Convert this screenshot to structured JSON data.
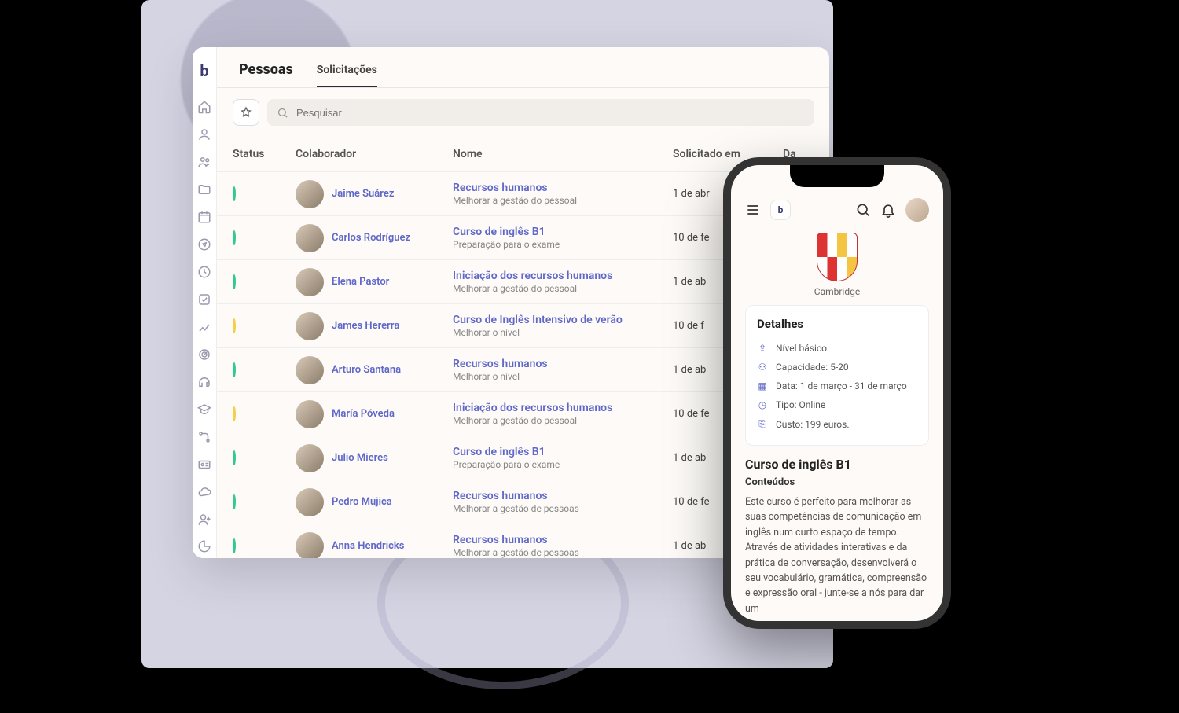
{
  "tabs": {
    "title": "Pessoas",
    "active": "Solicitações"
  },
  "search": {
    "placeholder": "Pesquisar"
  },
  "table": {
    "headers": {
      "status": "Status",
      "colaborador": "Colaborador",
      "nome": "Nome",
      "solicitado": "Solicitado em",
      "data": "Da"
    },
    "rows": [
      {
        "status": "green",
        "collab": "Jaime Suárez",
        "title": "Recursos humanos",
        "sub": "Melhorar a gestão do pessoal",
        "date": "1 de abr"
      },
      {
        "status": "green",
        "collab": "Carlos Rodríguez",
        "title": "Curso de inglês B1",
        "sub": "Preparação para o exame",
        "date": "10 de fe"
      },
      {
        "status": "green",
        "collab": "Elena Pastor",
        "title": "Iniciação dos recursos humanos",
        "sub": "Melhorar a gestão do pessoal",
        "date": "1 de ab"
      },
      {
        "status": "yellow",
        "collab": "James Hererra",
        "title": "Curso de Inglês Intensivo de verão",
        "sub": "Melhorar o nível",
        "date": "10 de f"
      },
      {
        "status": "green",
        "collab": "Arturo Santana",
        "title": "Recursos humanos",
        "sub": "Melhorar o nível",
        "date": "1 de ab"
      },
      {
        "status": "yellow",
        "collab": "María Póveda",
        "title": "Iniciação dos recursos humanos",
        "sub": "Melhorar a gestão do pessoal",
        "date": "10 de fe"
      },
      {
        "status": "green",
        "collab": "Julio Mieres",
        "title": "Curso de inglês B1",
        "sub": "Preparação para o exame",
        "date": "1 de ab"
      },
      {
        "status": "green",
        "collab": "Pedro Mujica",
        "title": "Recursos humanos",
        "sub": "Melhorar a gestão de pessoas",
        "date": "10 de fe"
      },
      {
        "status": "green",
        "collab": "Anna Hendricks",
        "title": "Recursos humanos",
        "sub": "Melhorar a gestão de pessoas",
        "date": "1 de ab"
      }
    ]
  },
  "phone": {
    "institution": "Cambridge",
    "details_heading": "Detalhes",
    "details": {
      "level": "Nível básico",
      "capacity": "Capacidade: 5-20",
      "dates": "Data: 1 de março - 31 de março",
      "type": "Tipo: Online",
      "cost": "Custo: 199 euros."
    },
    "course_title": "Curso de inglês B1",
    "course_subtitle": "Conteúdos",
    "course_description": "Este curso é perfeito para melhorar as suas competências de comunicação em inglês num curto espaço de tempo. Através de atividades interativas e da prática de conversação, desenvolverá o seu vocabulário, gramática, compreensão e expressão oral - junte-se a nós para dar um"
  }
}
